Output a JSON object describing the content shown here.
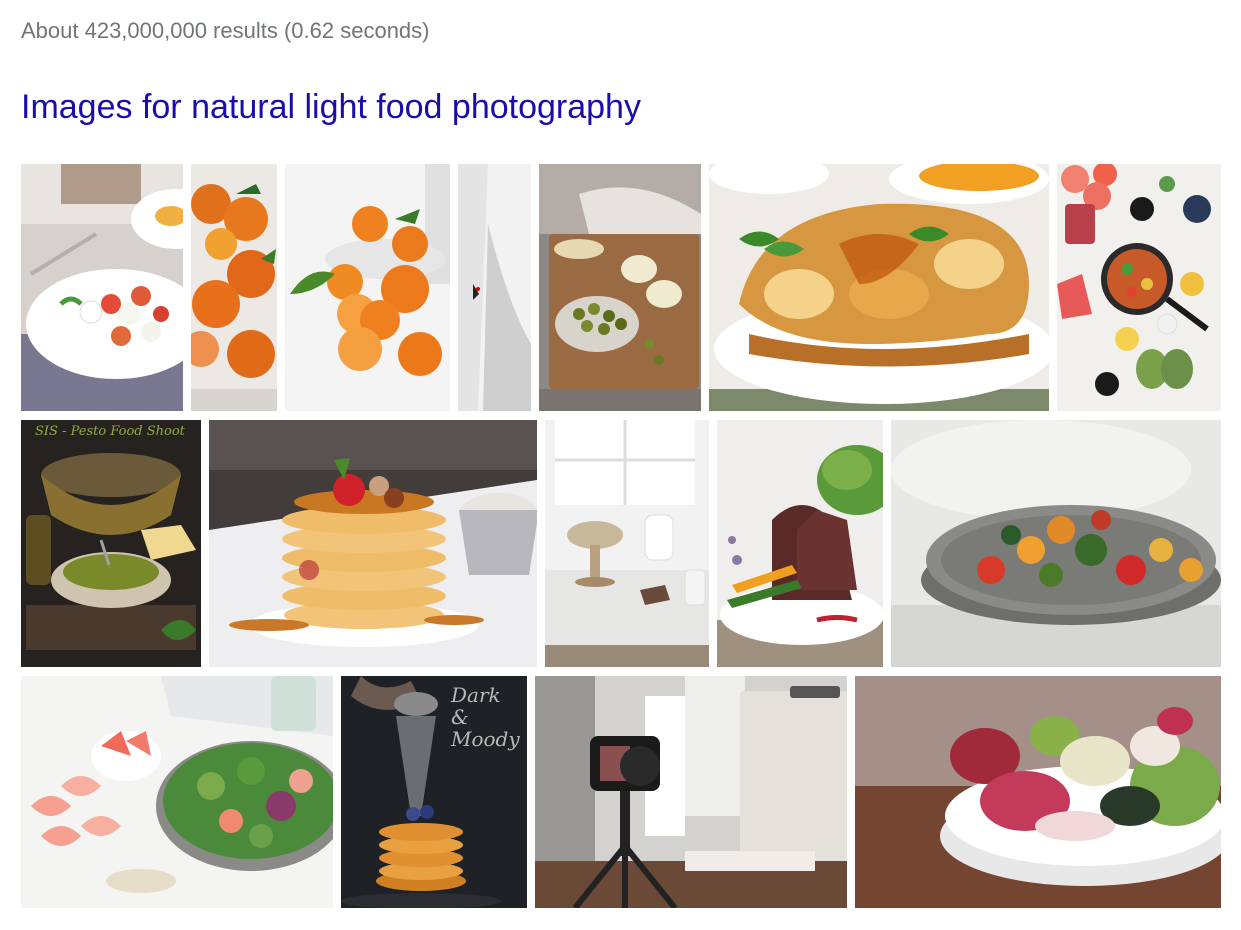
{
  "results_stats": "About 423,000,000 results (0.62 seconds)",
  "images_heading": "Images for natural light food photography",
  "thumbnails": [
    {
      "name": "caprese-salad-plate-image",
      "subject": "caprese salad with fork on plate",
      "colors": [
        "#d9d4cf",
        "#ffffff",
        "#e85a4a"
      ]
    },
    {
      "name": "tangerines-basket-image",
      "subject": "tangerines in basket",
      "colors": [
        "#e8e4e0",
        "#e8731c"
      ]
    },
    {
      "name": "oranges-on-white-image",
      "subject": "oranges and tangerines on white",
      "colors": [
        "#f4f4f4",
        "#f08a2a"
      ]
    },
    {
      "name": "white-fabric-image",
      "subject": "white draped fabric",
      "colors": [
        "#f0f0f0",
        "#c8c8c8"
      ]
    },
    {
      "name": "olives-board-image",
      "subject": "olives and dips on wooden board",
      "colors": [
        "#8a8480",
        "#9a6a40",
        "#6a7a2a"
      ]
    },
    {
      "name": "french-toast-image",
      "subject": "french toast with syrup and mint",
      "colors": [
        "#f4f0ea",
        "#d98a28",
        "#4a9a3a"
      ]
    },
    {
      "name": "overhead-breakfast-image",
      "subject": "overhead spread with skillet and citrus",
      "colors": [
        "#f4f2ee",
        "#e8504a",
        "#2a2a2a"
      ]
    },
    {
      "name": "pesto-food-shoot-image",
      "subject": "pesto food shoot dark scene",
      "overlay": "SIS - Pesto Food Shoot",
      "colors": [
        "#2a2420",
        "#8a7a3a",
        "#6a8a2a"
      ]
    },
    {
      "name": "pancake-stack-image",
      "subject": "pancake stack with berries and syrup",
      "colors": [
        "#4a4240",
        "#e0a050",
        "#c02020"
      ]
    },
    {
      "name": "cake-stand-table-image",
      "subject": "cake stand on bright table",
      "colors": [
        "#eeeeee",
        "#c8b89a"
      ]
    },
    {
      "name": "lamb-chops-image",
      "subject": "lamb chops with vegetables",
      "colors": [
        "#f0eeec",
        "#5a2a28",
        "#f0a020"
      ]
    },
    {
      "name": "roasted-vegetables-bowl-image",
      "subject": "roasted vegetables in grey bowl",
      "colors": [
        "#e8e8e6",
        "#7a7a76",
        "#d83a2a"
      ]
    },
    {
      "name": "grapefruit-salad-image",
      "subject": "grapefruit and green salad",
      "colors": [
        "#f4f4f2",
        "#f08070",
        "#4a8a3a"
      ]
    },
    {
      "name": "dark-and-moody-pancakes-image",
      "subject": "dark and moody pancake dusting",
      "overlay": "Dark & Moody",
      "colors": [
        "#1e2226",
        "#e09030",
        "#c0c4c8"
      ]
    },
    {
      "name": "camera-tripod-setup-image",
      "subject": "camera on tripod studio setup",
      "colors": [
        "#c8c6c2",
        "#2a2a2a",
        "#e0ddd8"
      ]
    },
    {
      "name": "salad-bowl-wood-image",
      "subject": "salad bowl on wooden table",
      "colors": [
        "#7a4a30",
        "#ffffff",
        "#a02a40"
      ]
    }
  ]
}
